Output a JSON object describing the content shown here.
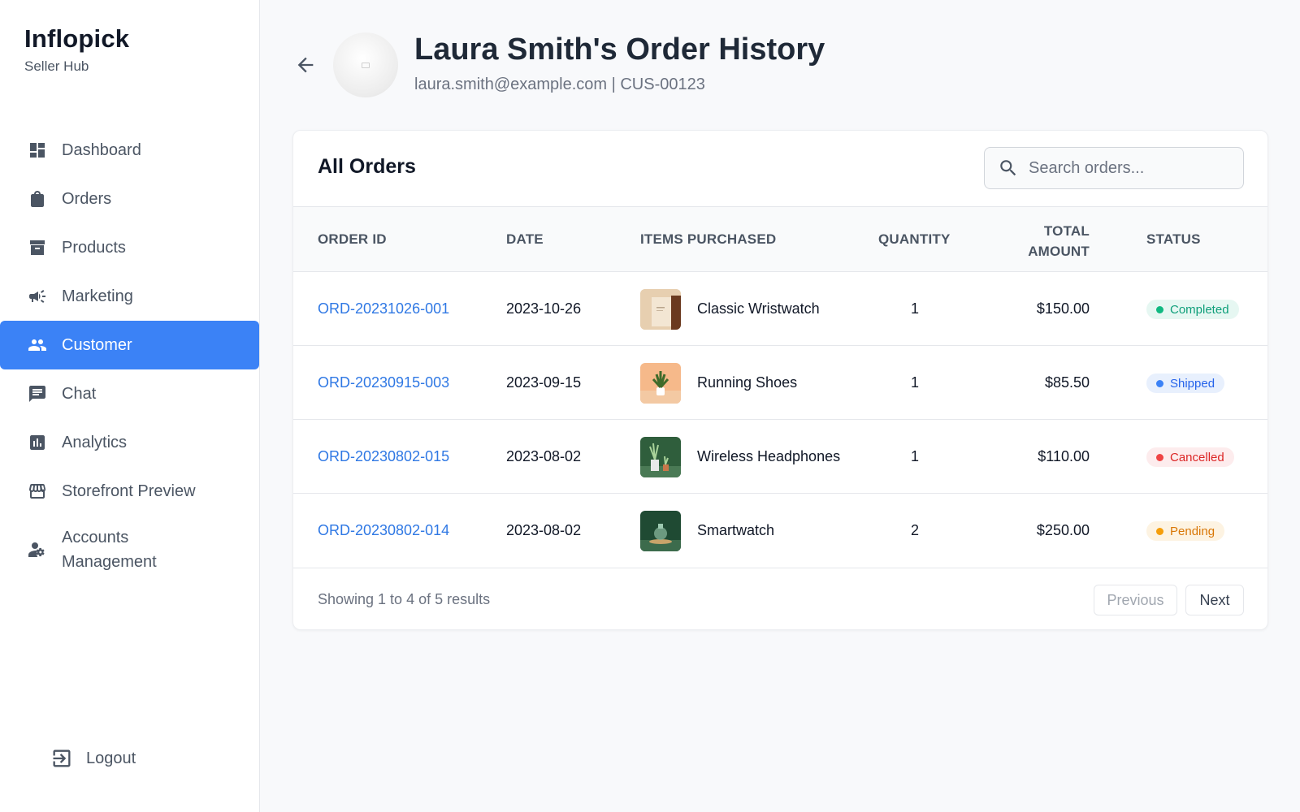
{
  "brand": {
    "name": "Inflopick",
    "subtitle": "Seller Hub"
  },
  "sidebar": {
    "items": [
      {
        "label": "Dashboard",
        "icon": "dashboard-icon",
        "active": false
      },
      {
        "label": "Orders",
        "icon": "shopping-bag-icon",
        "active": false
      },
      {
        "label": "Products",
        "icon": "archive-box-icon",
        "active": false
      },
      {
        "label": "Marketing",
        "icon": "megaphone-icon",
        "active": false
      },
      {
        "label": "Customer",
        "icon": "people-icon",
        "active": true
      },
      {
        "label": "Chat",
        "icon": "chat-icon",
        "active": false
      },
      {
        "label": "Analytics",
        "icon": "analytics-icon",
        "active": false
      },
      {
        "label": "Storefront Preview",
        "icon": "storefront-icon",
        "active": false
      },
      {
        "label": "Accounts Management",
        "icon": "user-settings-icon",
        "active": false
      }
    ],
    "logout_label": "Logout"
  },
  "header": {
    "title": "Laura Smith's Order History",
    "subtitle": "laura.smith@example.com | CUS-00123"
  },
  "orders": {
    "title": "All Orders",
    "search_placeholder": "Search orders...",
    "columns": {
      "order_id": "ORDER ID",
      "date": "DATE",
      "items": "ITEMS PURCHASED",
      "quantity": "QUANTITY",
      "total_line1": "TOTAL",
      "total_line2": "AMOUNT",
      "status": "STATUS"
    },
    "rows": [
      {
        "order_id": "ORD-20231026-001",
        "date": "2023-10-26",
        "item": "Classic Wristwatch",
        "quantity": "1",
        "total": "$150.00",
        "status": "Completed"
      },
      {
        "order_id": "ORD-20230915-003",
        "date": "2023-09-15",
        "item": "Running Shoes",
        "quantity": "1",
        "total": "$85.50",
        "status": "Shipped"
      },
      {
        "order_id": "ORD-20230802-015",
        "date": "2023-08-02",
        "item": "Wireless Headphones",
        "quantity": "1",
        "total": "$110.00",
        "status": "Cancelled"
      },
      {
        "order_id": "ORD-20230802-014",
        "date": "2023-08-02",
        "item": "Smartwatch",
        "quantity": "2",
        "total": "$250.00",
        "status": "Pending"
      }
    ],
    "status_colors": {
      "Completed": {
        "bg": "#e6f7f2",
        "fg": "#0f9f7a",
        "dot": "#10b981"
      },
      "Shipped": {
        "bg": "#e8f0fd",
        "fg": "#2563eb",
        "dot": "#3b82f6"
      },
      "Cancelled": {
        "bg": "#fdeced",
        "fg": "#dc2626",
        "dot": "#ef4444"
      },
      "Pending": {
        "bg": "#fdf3e2",
        "fg": "#d97706",
        "dot": "#f59e0b"
      }
    },
    "results_text": "Showing 1 to 4 of 5 results",
    "prev_label": "Previous",
    "next_label": "Next"
  },
  "colors": {
    "accent": "#3b82f6",
    "link": "#2f78e4"
  }
}
